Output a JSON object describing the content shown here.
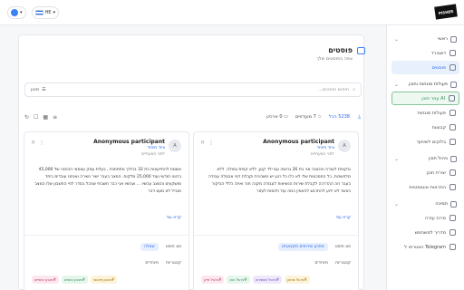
{
  "topbar": {
    "lang": "HE"
  },
  "sidebar": {
    "sections": [
      {
        "label": "ראשי",
        "items": [
          {
            "label": "דשבורד"
          },
          {
            "label": "פוסטים",
            "active": true
          }
        ]
      },
      {
        "label": "פעולות מונחות ותוכן",
        "items": [
          {
            "label": "AI עוזר תוכן",
            "green": true
          },
          {
            "label": "פעולות מונחות"
          },
          {
            "label": "קבוצות"
          },
          {
            "label": "בלוקים לשיתוף"
          }
        ]
      },
      {
        "label": "ניהול תוכן",
        "items": [
          {
            "label": "יצירת תוכן"
          },
          {
            "label": "התראות אוטומטיות"
          }
        ]
      },
      {
        "label": "תמיכה",
        "items": [
          {
            "label": "מרכז עזרה"
          },
          {
            "label": "מדריך למשתמש"
          },
          {
            "label": "Telegram הצטרפו ל"
          }
        ]
      }
    ]
  },
  "header": {
    "title": "פוסטים",
    "subtitle": "צפה בפוסטים שלך"
  },
  "search": {
    "placeholder": "חיפוש פוסטים...",
    "filter_label": "סינון"
  },
  "stats": {
    "total_label": "הכל",
    "total_value": "5238",
    "featured_label": "מועדפים",
    "featured_value": "7",
    "archive_label": "ארכיון",
    "archive_value": "0"
  },
  "cards": [
    {
      "name": "Anonymous participant",
      "role": "ציוד מיוחד",
      "time": "לפני כשעתיים",
      "avatar": "A",
      "body": "ובקופת לעזרה והכוונה אני בת 26 גרושה עם ילד קטן, ללא קופת גמולה. ללא מלחשכות, כל החסכונות שלי לא כלו כל רגע יש משכורת וקבלת דמי אבטלה עבודה בעבר וזה ההדרכה לקבלת שירות הנשיאות לעבודה מקנה תור ואיזה כללי הביקור כאשר לא ידוע להתרגש להאמין במה עוד ולנסות לעזור",
      "more": "קרא עוד",
      "type_label": "סוג פוסט",
      "type_value": "מתכון שירותים מקצועיים",
      "cat_label": "קטגוריות",
      "cat_value": "מיוחדים",
      "tags": [
        "#ניהול מחוון",
        "#ניהול משפחה",
        "#ניהול הוצ",
        "#ניהול תיק"
      ]
    },
    {
      "name": "Anonymous participant",
      "role": "ציוד מיוחד",
      "time": "לפני כשעתיים",
      "avatar": "A",
      "body": "אשמח להתייעצות בת 32 בהליך מתחתנת , בעלת עסק עצמאי הכנסה של 45,000 ברוטו חודשי ועוד 25,000 מלקוח. המצב בעבר ישיר נשירה ואנחנו עובדים ביחד מושקעים והמצב עכשיו ... ועכשיו אני כבר חשבתי שהכל בסדר לפי החשבון שלו המצב מוביל לא מעט דבר",
      "more": "קרא עוד",
      "type_label": "סוג פוסט",
      "type_value": "שאלה",
      "cat_label": "קטגוריות",
      "cat_value": "מיוחדים",
      "tags": [
        "#תכנון פיננסי",
        "#תכנון נכסים",
        "#תכנון אישיים"
      ]
    }
  ],
  "colors": {
    "accent": "#2563eb",
    "ai_green": "#2e8b57"
  }
}
